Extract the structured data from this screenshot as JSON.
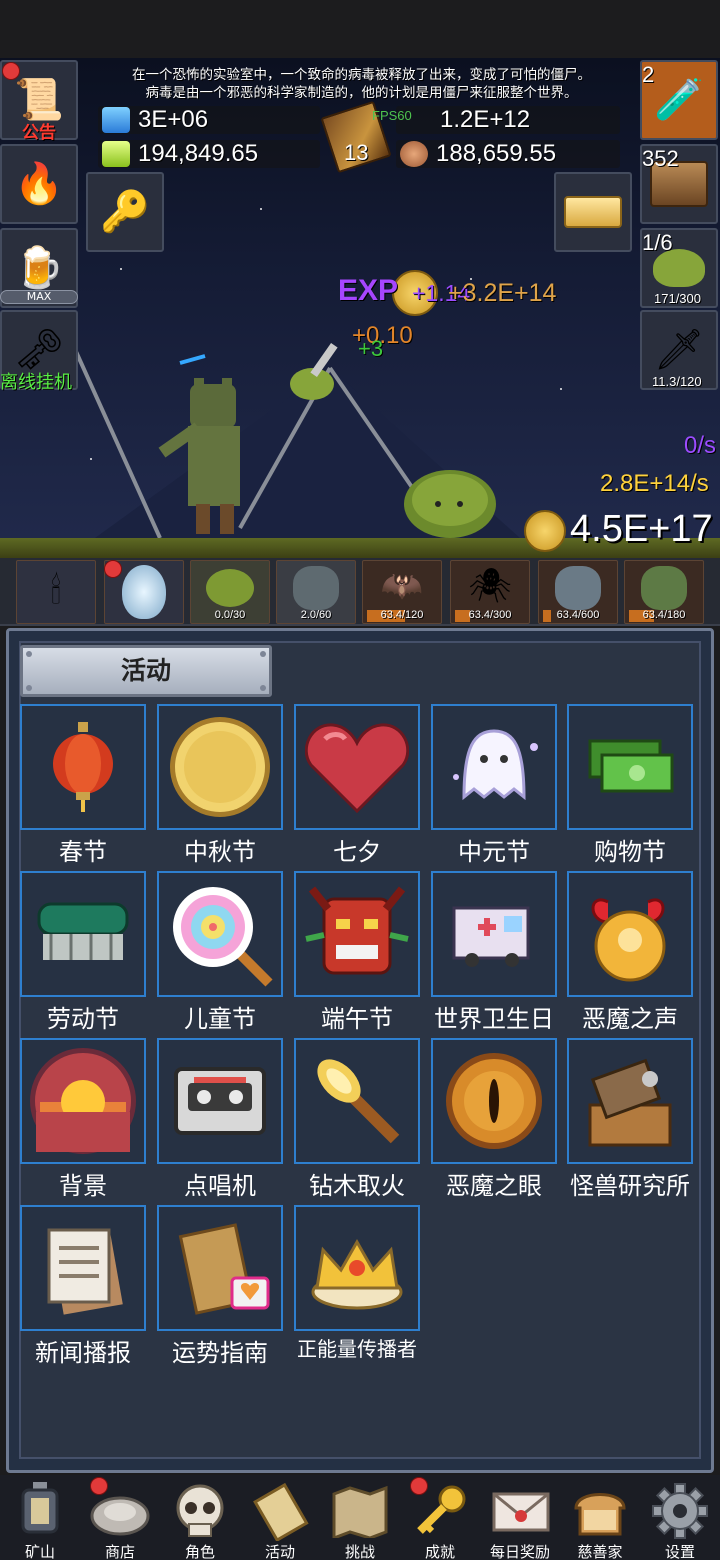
{
  "story": {
    "line1": "在一个恐怖的实验室中，一个致命的病毒被释放了出来，变成了可怕的僵尸。",
    "line2": "病毒是由一个邪恶的科学家制造的，他的计划是用僵尸来征服整个世界。"
  },
  "resources": {
    "blue_potion": "3E+06",
    "green_potion": "194,849.65",
    "fps": "FPS60",
    "book_level": "13",
    "book_value": "1.2E+12",
    "meat": "188,659.55"
  },
  "left_buttons": {
    "notice_label": "公告",
    "max_label": "MAX",
    "offline_label": "离线挂机"
  },
  "right_buttons": {
    "potion_count": "2",
    "chest_count": "352",
    "slime_fraction": "1/6",
    "slime_progress": "171/300",
    "sword_progress": "11.3/120"
  },
  "floating": {
    "exp": "EXP",
    "exp_gain": "+1.14",
    "coin_gain": "+3.2E+14",
    "orange_gain": "+0.10",
    "green_gain": "+3",
    "rate_purple": "0/s",
    "rate_gold": "2.8E+14/s",
    "gold_total": "4.5E+17"
  },
  "creatures": [
    {
      "label": "0.0/30",
      "fill": 0.0
    },
    {
      "label": "2.0/60",
      "fill": 0.033
    },
    {
      "label": "63.4/120",
      "fill": 0.53
    },
    {
      "label": "63.4/300",
      "fill": 0.21
    },
    {
      "label": "63.4/600",
      "fill": 0.11
    },
    {
      "label": "63.4/180",
      "fill": 0.35
    }
  ],
  "panel": {
    "title": "活动",
    "tiles": [
      {
        "label": "春节",
        "icon": "lantern-icon"
      },
      {
        "label": "中秋节",
        "icon": "mooncake-icon"
      },
      {
        "label": "七夕",
        "icon": "heart-icon"
      },
      {
        "label": "中元节",
        "icon": "ghost-icon"
      },
      {
        "label": "购物节",
        "icon": "money-icon"
      },
      {
        "label": "劳动节",
        "icon": "brush-icon"
      },
      {
        "label": "儿童节",
        "icon": "lollipop-icon"
      },
      {
        "label": "端午节",
        "icon": "dragon-mask-icon"
      },
      {
        "label": "世界卫生日",
        "icon": "ambulance-icon"
      },
      {
        "label": "恶魔之声",
        "icon": "bell-icon"
      },
      {
        "label": "背景",
        "icon": "sunset-icon"
      },
      {
        "label": "点唱机",
        "icon": "cassette-icon"
      },
      {
        "label": "钻木取火",
        "icon": "torch-icon"
      },
      {
        "label": "恶魔之眼",
        "icon": "eye-icon"
      },
      {
        "label": "怪兽研究所",
        "icon": "lab-icon"
      },
      {
        "label": "新闻播报",
        "icon": "newspaper-icon"
      },
      {
        "label": "运势指南",
        "icon": "fortune-icon"
      },
      {
        "label": "正能量传播者",
        "icon": "crown-icon"
      }
    ]
  },
  "nav": [
    {
      "label": "矿山",
      "icon": "lantern-icon",
      "dot": false
    },
    {
      "label": "商店",
      "icon": "shop-icon",
      "dot": true
    },
    {
      "label": "角色",
      "icon": "skull-icon",
      "dot": false
    },
    {
      "label": "活动",
      "icon": "scroll-icon",
      "dot": false
    },
    {
      "label": "挑战",
      "icon": "map-icon",
      "dot": false
    },
    {
      "label": "成就",
      "icon": "key-icon",
      "dot": true
    },
    {
      "label": "每日奖励",
      "icon": "mail-icon",
      "dot": false
    },
    {
      "label": "慈善家",
      "icon": "bread-icon",
      "dot": false
    },
    {
      "label": "设置",
      "icon": "gear-icon",
      "dot": false
    }
  ],
  "colors": {
    "tile_border": "#2e7fcf",
    "panel_bg": "#243044",
    "notice_red": "#ff3b30",
    "offline_green": "#59ee44",
    "rate_purple": "#9b4cff",
    "rate_gold": "#ffd23c"
  }
}
